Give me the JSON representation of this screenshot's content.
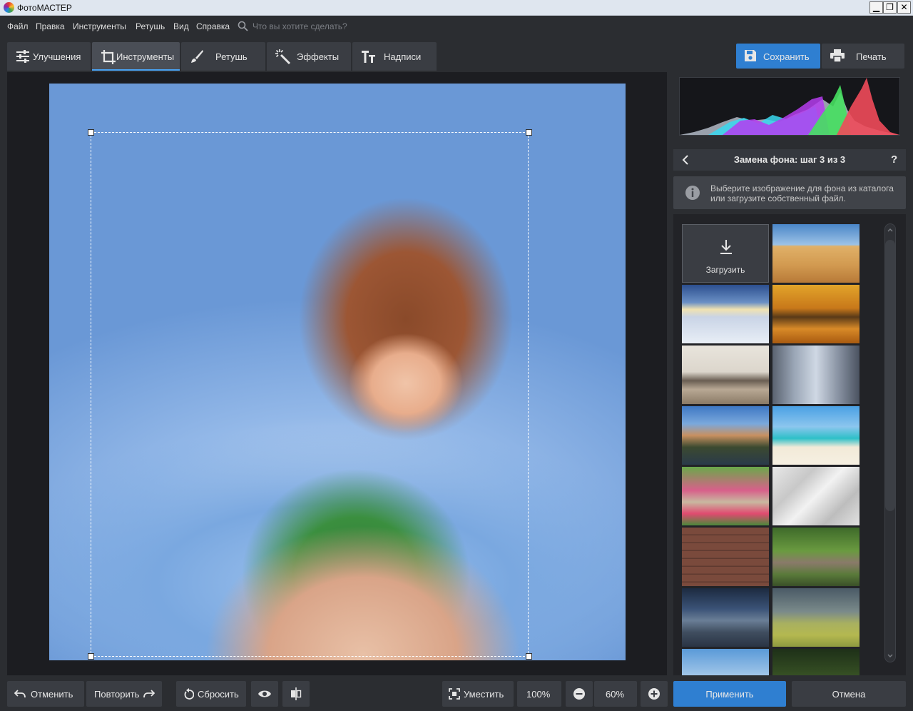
{
  "window": {
    "title": "ФотоМАСТЕР",
    "minimize": "▁",
    "maximize": "❐",
    "close": "✕"
  },
  "menu": {
    "items": [
      "Файл",
      "Правка",
      "Инструменты",
      "Ретушь",
      "Вид",
      "Справка"
    ],
    "search_placeholder": "Что вы хотите сделать?"
  },
  "tabs": [
    {
      "label": "Улучшения",
      "icon": "sliders-icon",
      "active": false
    },
    {
      "label": "Инструменты",
      "icon": "crop-icon",
      "active": true
    },
    {
      "label": "Ретушь",
      "icon": "brush-icon",
      "active": false
    },
    {
      "label": "Эффекты",
      "icon": "magic-wand-icon",
      "active": false
    },
    {
      "label": "Надписи",
      "icon": "text-icon",
      "active": false
    }
  ],
  "header_actions": {
    "save_label": "Сохранить",
    "print_label": "Печать"
  },
  "panel": {
    "step_title": "Замена фона: шаг 3 из 3",
    "help": "?",
    "info_text": "Выберите изображение для фона из каталога или загрузите собственный файл.",
    "upload_label": "Загрузить",
    "thumbnails": [
      "desert",
      "winter-road",
      "autumn-forest",
      "living-room",
      "city-street",
      "canal-town",
      "tropical-beach",
      "garden-path",
      "crumpled-paper",
      "brick-wall",
      "park-bikes",
      "stormy-city",
      "rainbow-hills",
      "mountains",
      "forest"
    ]
  },
  "bottom": {
    "undo_label": "Отменить",
    "redo_label": "Повторить",
    "reset_label": "Сбросить",
    "fit_label": "Уместить",
    "zoom_100": "100%",
    "zoom_value": "60%",
    "apply_label": "Применить",
    "cancel_label": "Отмена"
  },
  "colors": {
    "accent": "#2f7fd1",
    "background": "#2b2d31",
    "canvas": "#1c1d21",
    "active_tab_underline": "#4aa3f3"
  }
}
